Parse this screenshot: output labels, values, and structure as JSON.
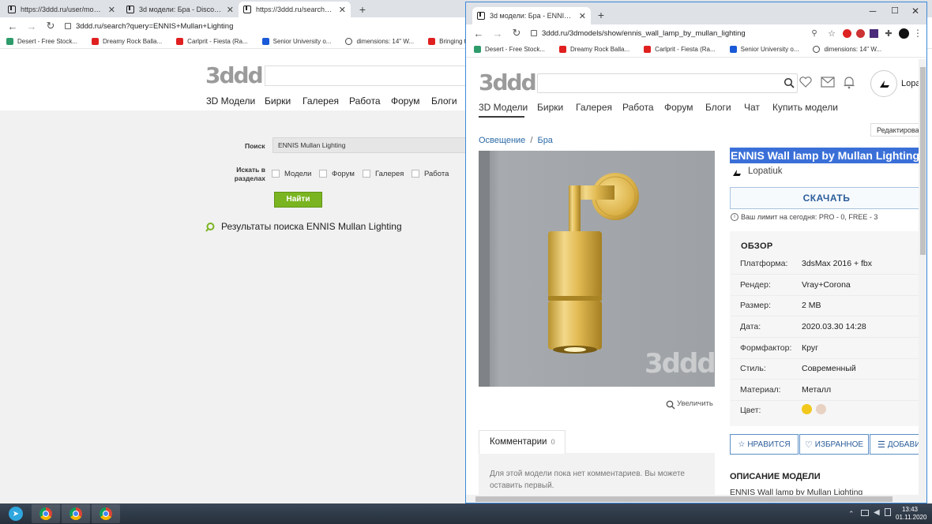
{
  "back_window": {
    "tabs": [
      {
        "title": "https://3ddd.ru/user/models?query"
      },
      {
        "title": "3d модели: Бра - Discovery Wall"
      },
      {
        "title": "https://3ddd.ru/search?query=E"
      }
    ],
    "url": "3ddd.ru/search?query=ENNIS+Mullan+Lighting",
    "bookmarks": [
      "Desert - Free Stock...",
      "Dreamy Rock Balla...",
      "Carlprit - Fiesta (Ra...",
      "Senior University o...",
      "dimensions: 14\" W...",
      "Bringing textures in..."
    ],
    "logo": "3ddd",
    "nav": [
      "3D Модели",
      "Бирки",
      "Галерея",
      "Работа",
      "Форум",
      "Блоги"
    ],
    "search_label": "Поиск",
    "search_value": "ENNIS Mullan Lighting",
    "sections_label": "Искать в разделах",
    "sections": [
      "Модели",
      "Форум",
      "Галерея",
      "Работа"
    ],
    "find_button": "Найти",
    "results_title": "Результаты поиска ENNIS Mullan Lighting"
  },
  "front_window": {
    "tab_title": "3d модели: Бра - ENNIS Wall lar",
    "url": "3ddd.ru/3dmodels/show/ennis_wall_lamp_by_mullan_lighting",
    "bookmarks": [
      "Desert - Free Stock...",
      "Dreamy Rock Balla...",
      "Carlprit - Fiesta (Ra...",
      "Senior University o...",
      "dimensions: 14\" W..."
    ],
    "logo": "3ddd",
    "user_name": "Lopa",
    "nav": [
      "3D Модели",
      "Бирки",
      "Галерея",
      "Работа",
      "Форум",
      "Блоги",
      "Чат",
      "Купить модели"
    ],
    "edit_button": "Редактировать",
    "breadcrumb": [
      "Освещение",
      "/",
      "Бра"
    ],
    "model_title": "ENNIS Wall lamp by Mullan Lighting",
    "author": "Lopatiuk",
    "download_button": "СКАЧАТЬ",
    "limit_text": "Ваш лимит на сегодня: PRO - 0, FREE - 3",
    "overview_title": "ОБЗОР",
    "specs": [
      {
        "label": "Платформа:",
        "value": "3dsMax 2016 + fbx"
      },
      {
        "label": "Рендер:",
        "value": "Vray+Corona"
      },
      {
        "label": "Размер:",
        "value": "2 MB"
      },
      {
        "label": "Дата:",
        "value": "2020.03.30 14:28"
      },
      {
        "label": "Формфактор:",
        "value": "Круг"
      },
      {
        "label": "Стиль:",
        "value": "Современный"
      },
      {
        "label": "Материал:",
        "value": "Металл"
      },
      {
        "label": "Цвет:",
        "value": ""
      }
    ],
    "colors": [
      "#f2c81c",
      "#e8d2c2"
    ],
    "zoom_link": "Увеличить",
    "watermark": "3ddd",
    "comments_tab": "Комментарии",
    "comments_count": "0",
    "comments_empty": [
      "Для этой модели пока нет комментариев. Вы можете",
      "оставить первый."
    ],
    "like_button": "НРАВИТСЯ",
    "favorite_button": "ИЗБРАННОЕ",
    "add_button": "ДОБАВИ",
    "description_title": "ОПИСАНИЕ МОДЕЛИ",
    "description_text": "ENNIS Wall lamp by Mullan Lighting"
  },
  "taskbar": {
    "time": "13:43",
    "date": "01.11.2020"
  },
  "colors": {
    "accent_blue": "#2b5d9a",
    "find_green": "#7ab521",
    "highlight": "#3a6fd8"
  }
}
